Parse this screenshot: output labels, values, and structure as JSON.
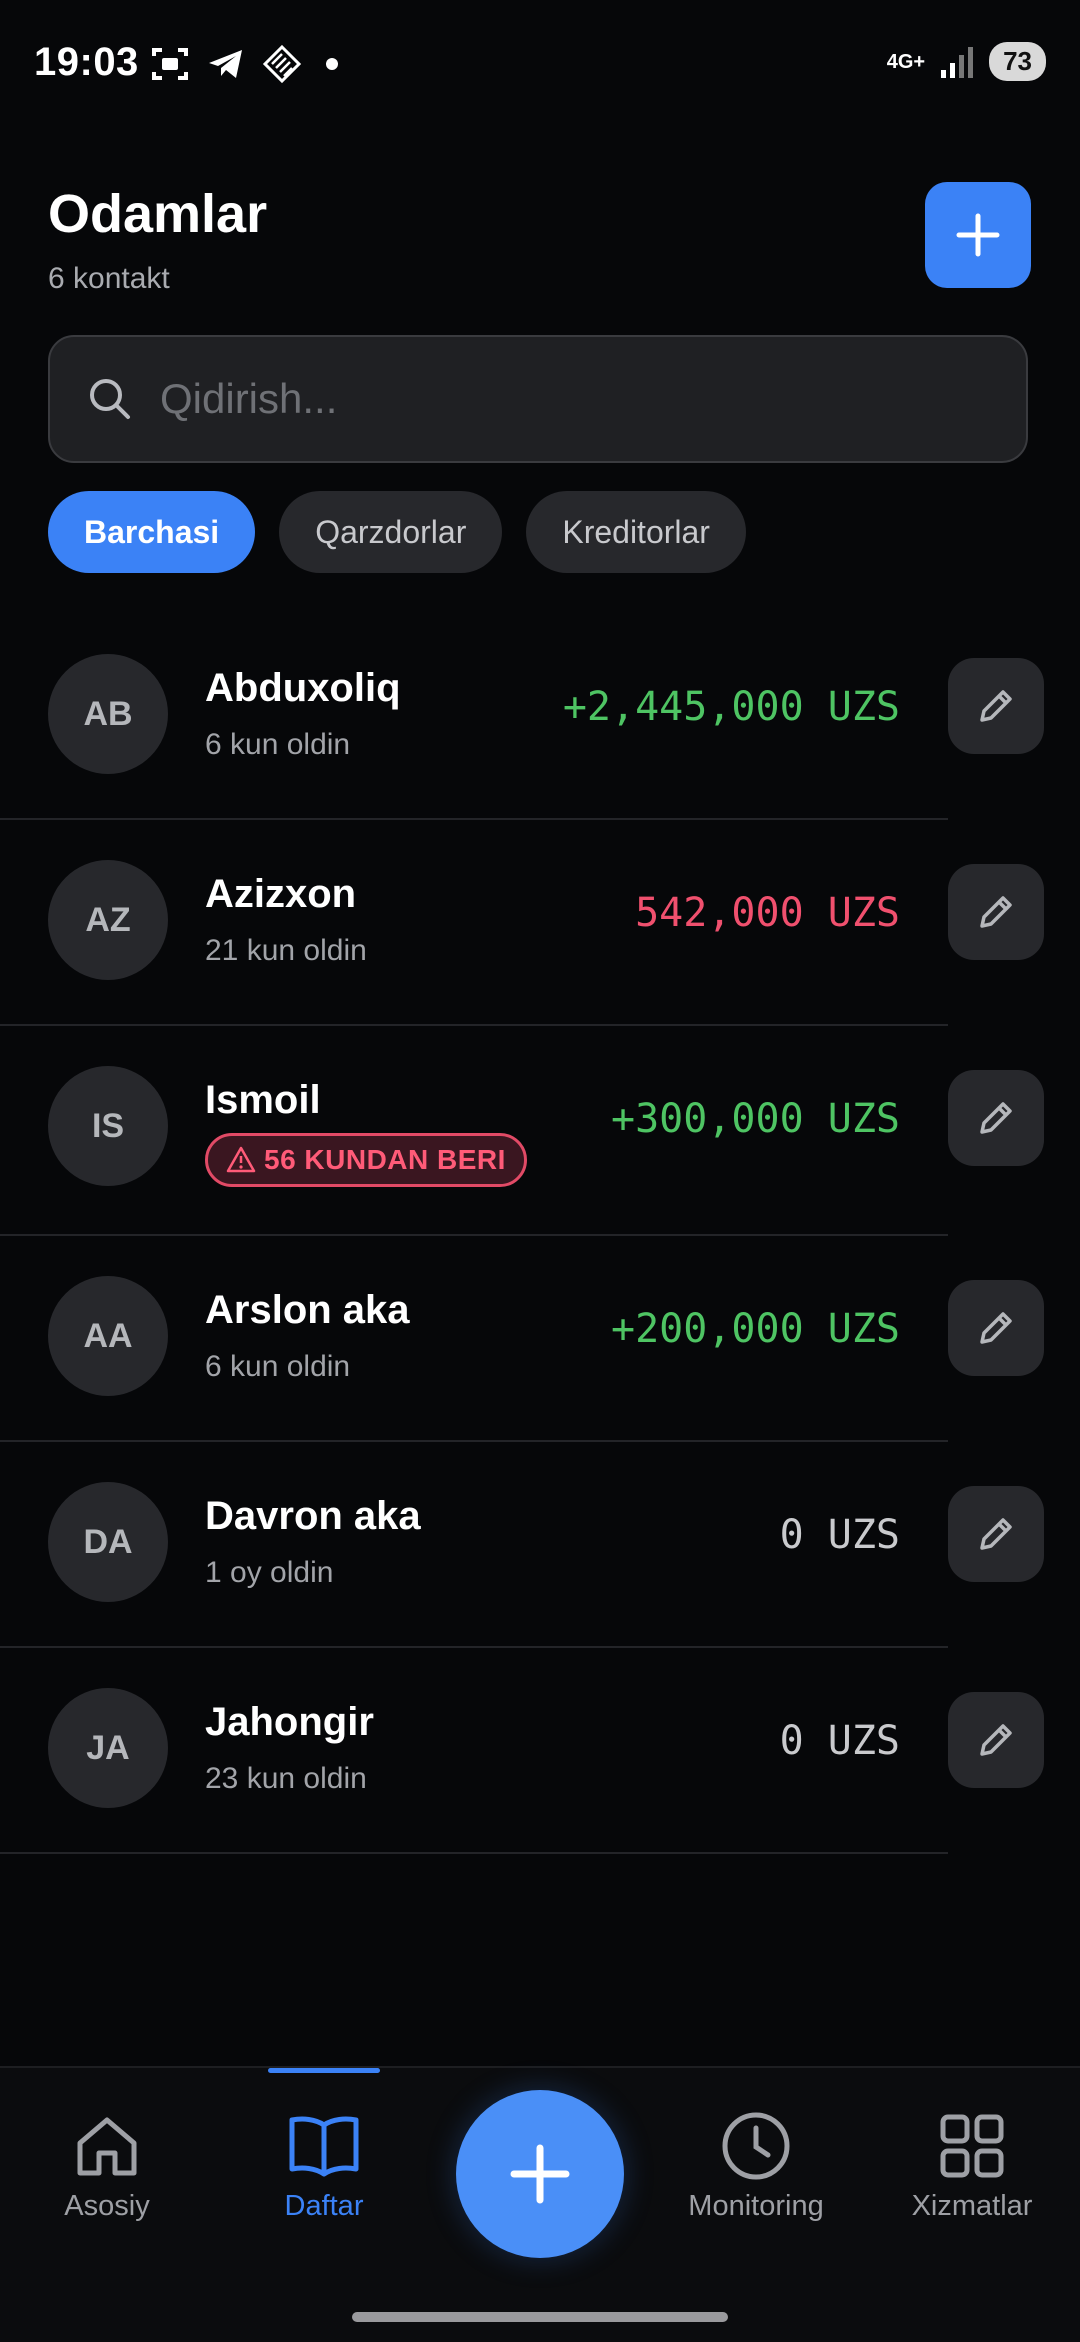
{
  "status_bar": {
    "time": "19:03",
    "network": "4G+",
    "battery": "73"
  },
  "header": {
    "title": "Odamlar",
    "subtitle": "6 kontakt"
  },
  "search": {
    "placeholder": "Qidirish..."
  },
  "filters": [
    {
      "label": "Barchasi",
      "active": true
    },
    {
      "label": "Qarzdorlar",
      "active": false
    },
    {
      "label": "Kreditorlar",
      "active": false
    }
  ],
  "contacts": [
    {
      "initials": "AB",
      "name": "Abduxoliq",
      "meta": "6 kun oldin",
      "amount": "+2,445,000 UZS",
      "amount_color": "#4ec463"
    },
    {
      "initials": "AZ",
      "name": "Azizxon",
      "meta": "21 kun oldin",
      "amount": "542,000 UZS",
      "amount_color": "#f0506e"
    },
    {
      "initials": "IS",
      "name": "Ismoil",
      "warning": "56 KUNDAN BERI",
      "amount": "+300,000 UZS",
      "amount_color": "#4ec463"
    },
    {
      "initials": "AA",
      "name": "Arslon aka",
      "meta": "6 kun oldin",
      "amount": "+200,000 UZS",
      "amount_color": "#4ec463"
    },
    {
      "initials": "DA",
      "name": "Davron aka",
      "meta": "1 oy oldin",
      "amount": "0 UZS",
      "amount_color": "#c9cacd"
    },
    {
      "initials": "JA",
      "name": "Jahongir",
      "meta": "23 kun oldin",
      "amount": "0 UZS",
      "amount_color": "#c9cacd"
    }
  ],
  "nav": {
    "home": "Asosiy",
    "daftar": "Daftar",
    "monitoring": "Monitoring",
    "services": "Xizmatlar"
  },
  "colors": {
    "accent": "#3b82f6",
    "positive": "#4ec463",
    "negative": "#f0506e"
  }
}
